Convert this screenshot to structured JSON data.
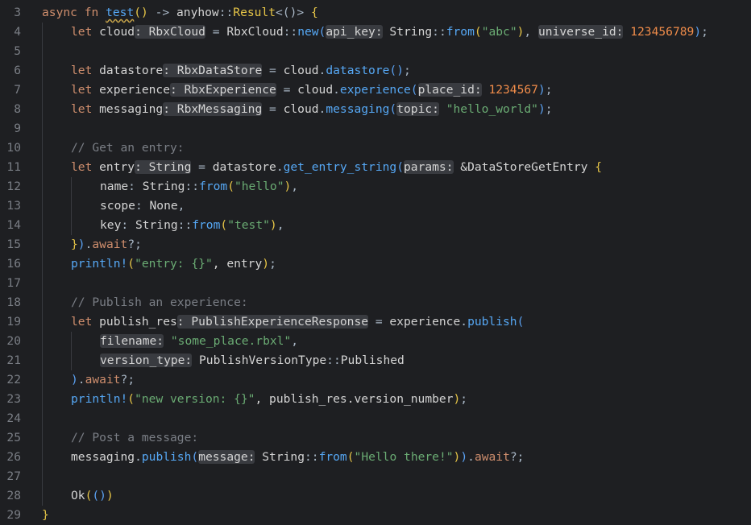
{
  "editor": {
    "background": "#1e1f22",
    "colors": {
      "keyword": "#cf8e6d",
      "function": "#56a8f5",
      "string": "#6aab73",
      "number": "#f08c4a",
      "comment": "#7a7e85",
      "brace": "#e6c547",
      "inlay_hint_bg": "#393b40"
    },
    "lines": [
      {
        "n": "3",
        "indent": 0,
        "tokens": [
          {
            "t": "async",
            "c": "kw"
          },
          {
            "t": " ",
            "c": "plain"
          },
          {
            "t": "fn",
            "c": "kw"
          },
          {
            "t": " ",
            "c": "plain"
          },
          {
            "t": "test",
            "c": "fnu"
          },
          {
            "t": "()",
            "c": "br"
          },
          {
            "t": " -> ",
            "c": "op"
          },
          {
            "t": "anyhow",
            "c": "mod"
          },
          {
            "t": "::",
            "c": "path"
          },
          {
            "t": "Result",
            "c": "type2"
          },
          {
            "t": "<()>",
            "c": "pun"
          },
          {
            "t": " ",
            "c": "plain"
          },
          {
            "t": "{",
            "c": "br"
          }
        ]
      },
      {
        "n": "4",
        "indent": 1,
        "tokens": [
          {
            "t": "let",
            "c": "kw"
          },
          {
            "t": " cloud",
            "c": "plain"
          },
          {
            "t": ": RbxCloud",
            "c": "hint"
          },
          {
            "t": " = ",
            "c": "op"
          },
          {
            "t": "RbxCloud",
            "c": "plain"
          },
          {
            "t": "::",
            "c": "path"
          },
          {
            "t": "new",
            "c": "fn"
          },
          {
            "t": "(",
            "c": "brb"
          },
          {
            "t": "api_key:",
            "c": "hint"
          },
          {
            "t": " String",
            "c": "plain"
          },
          {
            "t": "::",
            "c": "path"
          },
          {
            "t": "from",
            "c": "fn"
          },
          {
            "t": "(",
            "c": "br"
          },
          {
            "t": "\"abc\"",
            "c": "str"
          },
          {
            "t": ")",
            "c": "br"
          },
          {
            "t": ", ",
            "c": "pun"
          },
          {
            "t": "universe_id:",
            "c": "hint"
          },
          {
            "t": " ",
            "c": "plain"
          },
          {
            "t": "123456789",
            "c": "num"
          },
          {
            "t": ")",
            "c": "brb"
          },
          {
            "t": ";",
            "c": "pun"
          }
        ]
      },
      {
        "n": "5",
        "indent": 1,
        "tokens": []
      },
      {
        "n": "6",
        "indent": 1,
        "tokens": [
          {
            "t": "let",
            "c": "kw"
          },
          {
            "t": " datastore",
            "c": "plain"
          },
          {
            "t": ": RbxDataStore",
            "c": "hint"
          },
          {
            "t": " = ",
            "c": "op"
          },
          {
            "t": "cloud",
            "c": "plain"
          },
          {
            "t": ".",
            "c": "pun"
          },
          {
            "t": "datastore",
            "c": "fn"
          },
          {
            "t": "()",
            "c": "brb"
          },
          {
            "t": ";",
            "c": "pun"
          }
        ]
      },
      {
        "n": "7",
        "indent": 1,
        "tokens": [
          {
            "t": "let",
            "c": "kw"
          },
          {
            "t": " experience",
            "c": "plain"
          },
          {
            "t": ": RbxExperience",
            "c": "hint"
          },
          {
            "t": " = ",
            "c": "op"
          },
          {
            "t": "cloud",
            "c": "plain"
          },
          {
            "t": ".",
            "c": "pun"
          },
          {
            "t": "experience",
            "c": "fn"
          },
          {
            "t": "(",
            "c": "brb"
          },
          {
            "t": "place_id:",
            "c": "hint"
          },
          {
            "t": " ",
            "c": "plain"
          },
          {
            "t": "1234567",
            "c": "num"
          },
          {
            "t": ")",
            "c": "brb"
          },
          {
            "t": ";",
            "c": "pun"
          }
        ]
      },
      {
        "n": "8",
        "indent": 1,
        "tokens": [
          {
            "t": "let",
            "c": "kw"
          },
          {
            "t": " messaging",
            "c": "plain"
          },
          {
            "t": ": RbxMessaging",
            "c": "hint"
          },
          {
            "t": " = ",
            "c": "op"
          },
          {
            "t": "cloud",
            "c": "plain"
          },
          {
            "t": ".",
            "c": "pun"
          },
          {
            "t": "messaging",
            "c": "fn"
          },
          {
            "t": "(",
            "c": "brb"
          },
          {
            "t": "topic:",
            "c": "hint"
          },
          {
            "t": " ",
            "c": "plain"
          },
          {
            "t": "\"hello_world\"",
            "c": "str"
          },
          {
            "t": ")",
            "c": "brb"
          },
          {
            "t": ";",
            "c": "pun"
          }
        ]
      },
      {
        "n": "9",
        "indent": 1,
        "tokens": []
      },
      {
        "n": "10",
        "indent": 1,
        "tokens": [
          {
            "t": "// Get an entry:",
            "c": "cm"
          }
        ]
      },
      {
        "n": "11",
        "indent": 1,
        "tokens": [
          {
            "t": "let",
            "c": "kw"
          },
          {
            "t": " entry",
            "c": "plain"
          },
          {
            "t": ": String",
            "c": "hint"
          },
          {
            "t": " = ",
            "c": "op"
          },
          {
            "t": "datastore",
            "c": "plain"
          },
          {
            "t": ".",
            "c": "pun"
          },
          {
            "t": "get_entry_string",
            "c": "fn"
          },
          {
            "t": "(",
            "c": "brb"
          },
          {
            "t": "params:",
            "c": "hint"
          },
          {
            "t": " &DataStoreGetEntry ",
            "c": "plain"
          },
          {
            "t": "{",
            "c": "br"
          }
        ]
      },
      {
        "n": "12",
        "indent": 2,
        "tokens": [
          {
            "t": "name",
            "c": "plain"
          },
          {
            "t": ": ",
            "c": "pun"
          },
          {
            "t": "String",
            "c": "plain"
          },
          {
            "t": "::",
            "c": "path"
          },
          {
            "t": "from",
            "c": "fn"
          },
          {
            "t": "(",
            "c": "br"
          },
          {
            "t": "\"hello\"",
            "c": "str"
          },
          {
            "t": ")",
            "c": "br"
          },
          {
            "t": ",",
            "c": "pun"
          }
        ]
      },
      {
        "n": "13",
        "indent": 2,
        "tokens": [
          {
            "t": "scope",
            "c": "plain"
          },
          {
            "t": ": ",
            "c": "pun"
          },
          {
            "t": "None",
            "c": "plain"
          },
          {
            "t": ",",
            "c": "pun"
          }
        ]
      },
      {
        "n": "14",
        "indent": 2,
        "tokens": [
          {
            "t": "key",
            "c": "plain"
          },
          {
            "t": ": ",
            "c": "pun"
          },
          {
            "t": "String",
            "c": "plain"
          },
          {
            "t": "::",
            "c": "path"
          },
          {
            "t": "from",
            "c": "fn"
          },
          {
            "t": "(",
            "c": "br"
          },
          {
            "t": "\"test\"",
            "c": "str"
          },
          {
            "t": ")",
            "c": "br"
          },
          {
            "t": ",",
            "c": "pun"
          }
        ]
      },
      {
        "n": "15",
        "indent": 1,
        "tokens": [
          {
            "t": "}",
            "c": "br"
          },
          {
            "t": ")",
            "c": "brb"
          },
          {
            "t": ".",
            "c": "pun"
          },
          {
            "t": "await",
            "c": "kw"
          },
          {
            "t": "?;",
            "c": "pun"
          }
        ]
      },
      {
        "n": "16",
        "indent": 1,
        "tokens": [
          {
            "t": "println!",
            "c": "fn"
          },
          {
            "t": "(",
            "c": "br"
          },
          {
            "t": "\"entry: {}\"",
            "c": "str"
          },
          {
            "t": ", entry",
            "c": "plain"
          },
          {
            "t": ")",
            "c": "br"
          },
          {
            "t": ";",
            "c": "pun"
          }
        ]
      },
      {
        "n": "17",
        "indent": 1,
        "tokens": []
      },
      {
        "n": "18",
        "indent": 1,
        "tokens": [
          {
            "t": "// Publish an experience:",
            "c": "cm"
          }
        ]
      },
      {
        "n": "19",
        "indent": 1,
        "tokens": [
          {
            "t": "let",
            "c": "kw"
          },
          {
            "t": " publish_res",
            "c": "plain"
          },
          {
            "t": ": PublishExperienceResponse",
            "c": "hint"
          },
          {
            "t": " = ",
            "c": "op"
          },
          {
            "t": "experience",
            "c": "plain"
          },
          {
            "t": ".",
            "c": "pun"
          },
          {
            "t": "publish",
            "c": "fn"
          },
          {
            "t": "(",
            "c": "brb"
          }
        ]
      },
      {
        "n": "20",
        "indent": 2,
        "tokens": [
          {
            "t": "filename:",
            "c": "hint"
          },
          {
            "t": " ",
            "c": "plain"
          },
          {
            "t": "\"some_place.rbxl\"",
            "c": "str"
          },
          {
            "t": ",",
            "c": "pun"
          }
        ]
      },
      {
        "n": "21",
        "indent": 2,
        "tokens": [
          {
            "t": "version_type:",
            "c": "hint"
          },
          {
            "t": " PublishVersionType",
            "c": "plain"
          },
          {
            "t": "::",
            "c": "path"
          },
          {
            "t": "Published",
            "c": "plain"
          }
        ]
      },
      {
        "n": "22",
        "indent": 1,
        "tokens": [
          {
            "t": ")",
            "c": "brb"
          },
          {
            "t": ".",
            "c": "pun"
          },
          {
            "t": "await",
            "c": "kw"
          },
          {
            "t": "?;",
            "c": "pun"
          }
        ]
      },
      {
        "n": "23",
        "indent": 1,
        "tokens": [
          {
            "t": "println!",
            "c": "fn"
          },
          {
            "t": "(",
            "c": "br"
          },
          {
            "t": "\"new version: {}\"",
            "c": "str"
          },
          {
            "t": ", publish_res.version_number",
            "c": "plain"
          },
          {
            "t": ")",
            "c": "br"
          },
          {
            "t": ";",
            "c": "pun"
          }
        ]
      },
      {
        "n": "24",
        "indent": 1,
        "tokens": []
      },
      {
        "n": "25",
        "indent": 1,
        "tokens": [
          {
            "t": "// Post a message:",
            "c": "cm"
          }
        ]
      },
      {
        "n": "26",
        "indent": 1,
        "tokens": [
          {
            "t": "messaging",
            "c": "plain"
          },
          {
            "t": ".",
            "c": "pun"
          },
          {
            "t": "publish",
            "c": "fn"
          },
          {
            "t": "(",
            "c": "brb"
          },
          {
            "t": "message:",
            "c": "hint"
          },
          {
            "t": " String",
            "c": "plain"
          },
          {
            "t": "::",
            "c": "path"
          },
          {
            "t": "from",
            "c": "fn"
          },
          {
            "t": "(",
            "c": "br"
          },
          {
            "t": "\"Hello there!\"",
            "c": "str"
          },
          {
            "t": ")",
            "c": "br"
          },
          {
            "t": ")",
            "c": "brb"
          },
          {
            "t": ".",
            "c": "pun"
          },
          {
            "t": "await",
            "c": "kw"
          },
          {
            "t": "?;",
            "c": "pun"
          }
        ]
      },
      {
        "n": "27",
        "indent": 1,
        "tokens": []
      },
      {
        "n": "28",
        "indent": 1,
        "tokens": [
          {
            "t": "Ok",
            "c": "plain"
          },
          {
            "t": "(",
            "c": "br"
          },
          {
            "t": "()",
            "c": "brb"
          },
          {
            "t": ")",
            "c": "br"
          }
        ]
      },
      {
        "n": "29",
        "indent": 0,
        "tokens": [
          {
            "t": "}",
            "c": "br"
          }
        ]
      }
    ]
  }
}
